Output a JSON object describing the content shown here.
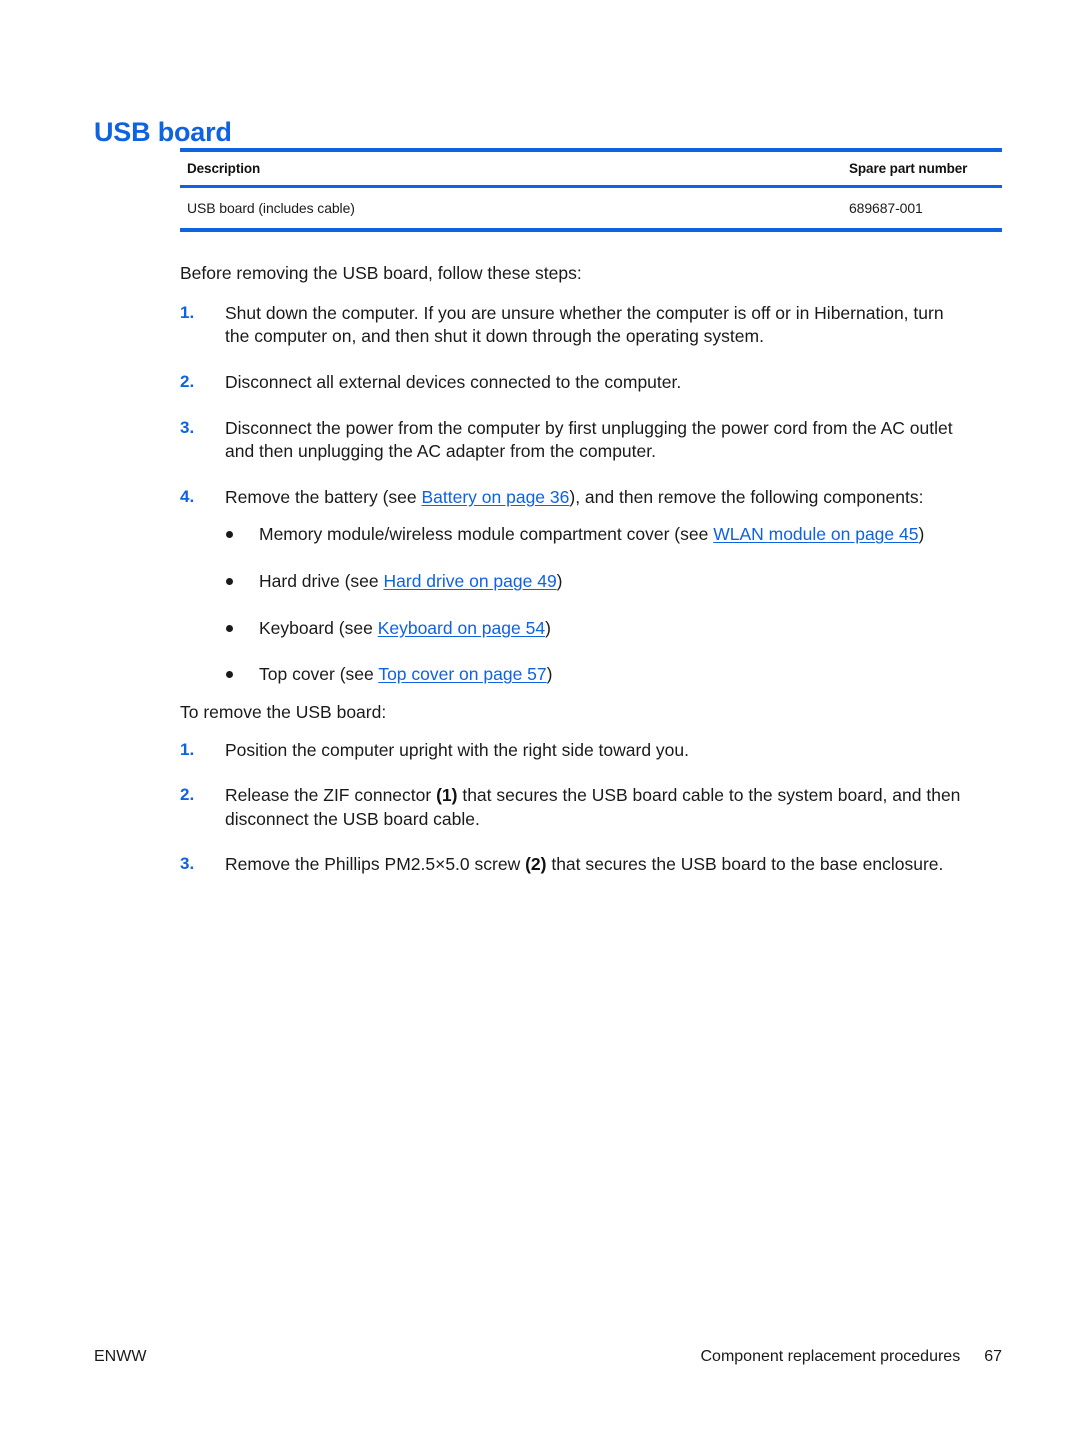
{
  "document": {
    "heading": "USB board",
    "footer": {
      "left_label": "ENWW",
      "section_label": "Component replacement procedures",
      "page_number": "67"
    }
  },
  "spec_table": {
    "columns": [
      "Description",
      "Spare part number"
    ],
    "rows": [
      {
        "description": "USB board (includes cable)",
        "spare_part_number": "689687-001"
      }
    ]
  },
  "before_section": {
    "lead": "Before removing the USB board, follow these steps:",
    "steps": [
      {
        "number": "1.",
        "text": "Shut down the computer. If you are unsure whether the computer is off or in Hibernation, turn the computer on, and then shut it down through the operating system."
      },
      {
        "number": "2.",
        "text": "Disconnect all external devices connected to the computer."
      },
      {
        "number": "3.",
        "text": "Disconnect the power from the computer by first unplugging the power cord from the AC outlet and then unplugging the AC adapter from the computer."
      },
      {
        "number": "4.",
        "text_before_link": "Remove the battery (see ",
        "link": "Battery on page 36",
        "text_after_link": "), and then remove the following components:",
        "bullets": [
          {
            "text_before_link": "Memory module/wireless module compartment cover (see ",
            "link": "WLAN module on page 45",
            "text_after_link": ")"
          },
          {
            "text_before_link": "Hard drive (see ",
            "link": "Hard drive on page 49",
            "text_after_link": ")"
          },
          {
            "text_before_link": "Keyboard (see ",
            "link": "Keyboard on page 54",
            "text_after_link": ")"
          },
          {
            "text_before_link": "Top cover (see ",
            "link": "Top cover on page 57",
            "text_after_link": ")"
          }
        ]
      }
    ]
  },
  "remove_section": {
    "lead": "To remove the USB board:",
    "steps": [
      {
        "number": "1.",
        "text": "Position the computer upright with the right side toward you."
      },
      {
        "number": "2.",
        "part_a": "Release the ZIF connector ",
        "callout": "(1)",
        "part_b": " that secures the USB board cable to the system board, and then disconnect the USB board cable."
      },
      {
        "number": "3.",
        "part_a": "Remove the Phillips PM2.5×5.0 screw ",
        "callout": "(2)",
        "part_b": " that secures the USB board to the base enclosure."
      }
    ]
  },
  "theme": {
    "accent_blue": "#0f62e0",
    "text_color": "#1a1a1a",
    "page_background": "#ffffff"
  }
}
